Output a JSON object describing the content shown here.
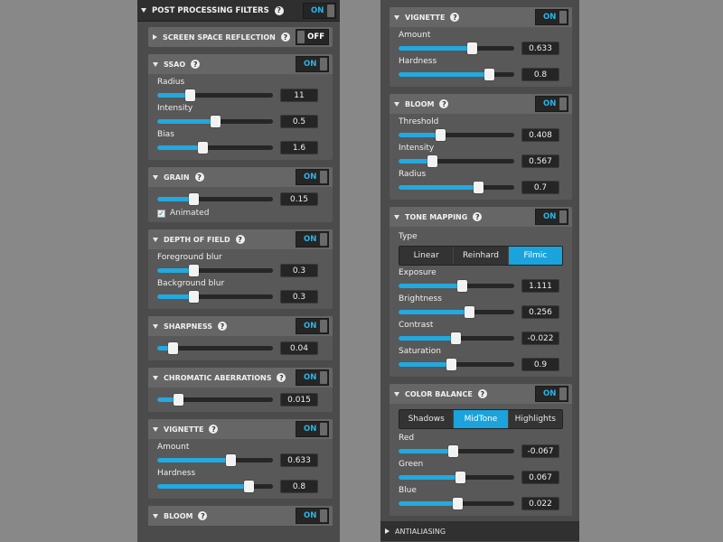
{
  "left": {
    "header": {
      "title": "POST PROCESSING FILTERS",
      "toggle": "ON"
    },
    "panels": {
      "ssr": {
        "title": "SCREEN SPACE REFLECTION",
        "toggle": "OFF"
      },
      "ssao": {
        "title": "SSAO",
        "toggle": "ON",
        "params": [
          {
            "label": "Radius",
            "value": "11",
            "level": 0.28
          },
          {
            "label": "Intensity",
            "value": "0.5",
            "level": 0.5
          },
          {
            "label": "Bias",
            "value": "1.6",
            "level": 0.39
          }
        ]
      },
      "grain": {
        "title": "GRAIN",
        "toggle": "ON",
        "value": "0.15",
        "level": 0.31,
        "checkbox_label": "Animated",
        "checked": true
      },
      "dof": {
        "title": "DEPTH OF FIELD",
        "toggle": "ON",
        "params": [
          {
            "label": "Foreground blur",
            "value": "0.3",
            "level": 0.31
          },
          {
            "label": "Background blur",
            "value": "0.3",
            "level": 0.31
          }
        ]
      },
      "sharpness": {
        "title": "SHARPNESS",
        "toggle": "ON",
        "value": "0.04",
        "level": 0.13
      },
      "chromatic": {
        "title": "CHROMATIC ABERRATIONS",
        "toggle": "ON",
        "value": "0.015",
        "level": 0.18
      },
      "vignette": {
        "title": "VIGNETTE",
        "toggle": "ON",
        "params": [
          {
            "label": "Amount",
            "value": "0.633",
            "level": 0.63
          },
          {
            "label": "Hardness",
            "value": "0.8",
            "level": 0.79
          }
        ]
      },
      "bloom": {
        "title": "BLOOM",
        "toggle": "ON"
      }
    }
  },
  "right": {
    "panels": {
      "vignette": {
        "title": "VIGNETTE",
        "toggle": "ON",
        "params": [
          {
            "label": "Amount",
            "value": "0.633",
            "level": 0.63
          },
          {
            "label": "Hardness",
            "value": "0.8",
            "level": 0.78
          }
        ]
      },
      "bloom": {
        "title": "BLOOM",
        "toggle": "ON",
        "params": [
          {
            "label": "Threshold",
            "value": "0.408",
            "level": 0.36
          },
          {
            "label": "Intensity",
            "value": "0.567",
            "level": 0.29
          },
          {
            "label": "Radius",
            "value": "0.7",
            "level": 0.69
          }
        ]
      },
      "tonemapping": {
        "title": "TONE MAPPING",
        "toggle": "ON",
        "type_label": "Type",
        "types": [
          "Linear",
          "Reinhard",
          "Filmic"
        ],
        "selected_type": 2,
        "params": [
          {
            "label": "Exposure",
            "value": "1.111",
            "level": 0.55
          },
          {
            "label": "Brightness",
            "value": "0.256",
            "level": 0.61
          },
          {
            "label": "Contrast",
            "value": "-0.022",
            "level": 0.49
          },
          {
            "label": "Saturation",
            "value": "0.9",
            "level": 0.45
          }
        ]
      },
      "colorbalance": {
        "title": "COLOR BALANCE",
        "toggle": "ON",
        "ranges": [
          "Shadows",
          "MidTone",
          "Highlights"
        ],
        "selected_range": 1,
        "params": [
          {
            "label": "Red",
            "value": "-0.067",
            "level": 0.47
          },
          {
            "label": "Green",
            "value": "0.067",
            "level": 0.53
          },
          {
            "label": "Blue",
            "value": "0.022",
            "level": 0.51
          }
        ]
      }
    },
    "antialiasing": {
      "title": "ANTIALIASING"
    }
  },
  "colors": {
    "accent": "#1aa3dc",
    "panel": "#585858",
    "panel_header": "#666666",
    "value_bg": "#252525"
  }
}
